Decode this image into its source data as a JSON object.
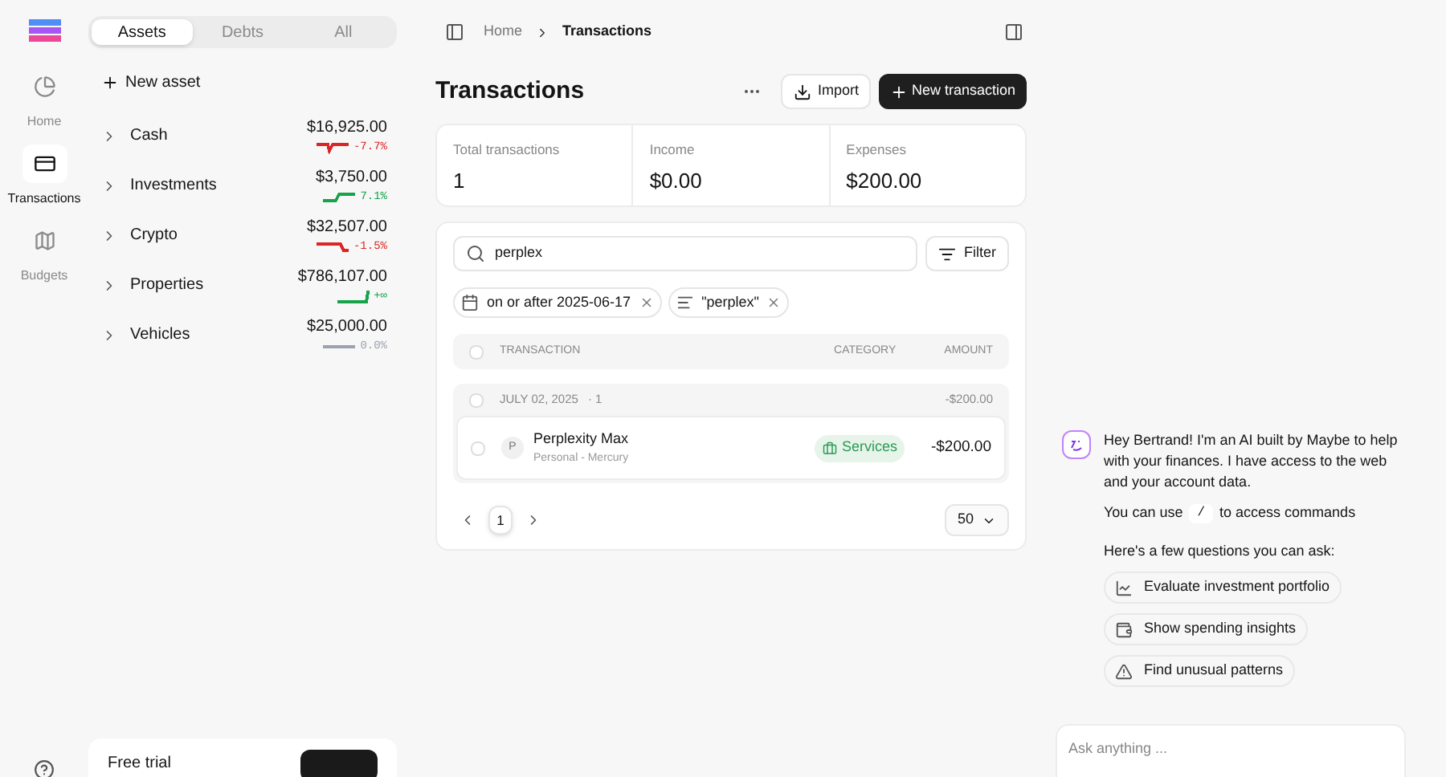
{
  "nav": [
    {
      "label": "Home",
      "selected": false
    },
    {
      "label": "Transactions",
      "selected": true
    },
    {
      "label": "Budgets",
      "selected": false
    }
  ],
  "sidebar": {
    "tabs": [
      {
        "label": "Assets",
        "selected": true
      },
      {
        "label": "Debts",
        "selected": false
      },
      {
        "label": "All",
        "selected": false
      }
    ],
    "new_button": "New asset",
    "accounts": [
      {
        "name": "Cash",
        "amount": "$16,925.00",
        "change": "-7.7%",
        "color": "#dc2626"
      },
      {
        "name": "Investments",
        "amount": "$3,750.00",
        "change": "7.1%",
        "color": "#16a34a"
      },
      {
        "name": "Crypto",
        "amount": "$32,507.00",
        "change": "-1.5%",
        "color": "#dc2626"
      },
      {
        "name": "Properties",
        "amount": "$786,107.00",
        "change": "+∞",
        "color": "#16a34a"
      },
      {
        "name": "Vehicles",
        "amount": "$25,000.00",
        "change": "0.0%",
        "color": "#9ca3af"
      }
    ],
    "trial_card": {
      "title": "Free trial"
    }
  },
  "breadcrumb": [
    "Home",
    "Transactions"
  ],
  "page_title": "Transactions",
  "actions": {
    "import": "Import",
    "new": "New transaction"
  },
  "stats": [
    {
      "label": "Total transactions",
      "value": "1"
    },
    {
      "label": "Income",
      "value": "$0.00"
    },
    {
      "label": "Expenses",
      "value": "$200.00"
    }
  ],
  "search": {
    "value": "perplex"
  },
  "filter_button": "Filter",
  "filters": [
    {
      "kind": "date",
      "label": "on or after 2025-06-17"
    },
    {
      "kind": "text",
      "label": "\"perplex\""
    }
  ],
  "table": {
    "columns": [
      "TRANSACTION",
      "CATEGORY",
      "AMOUNT"
    ],
    "select_all_checked": false,
    "groups": [
      {
        "date": "JULY 02, 2025",
        "count": "· 1",
        "total": "-$200.00",
        "checked": false,
        "rows": [
          {
            "initial": "P",
            "name": "Perplexity Max",
            "account": "Personal - Mercury",
            "category": "Services",
            "amount": "-$200.00",
            "checked": false
          }
        ]
      }
    ]
  },
  "pagination": {
    "pages": [
      {
        "label": "1",
        "selected": true
      }
    ],
    "per_page": "50"
  },
  "chat": {
    "greeting": "Hey Bertrand! I'm an AI built by Maybe to help with your finances. I have access to the web and your account data.",
    "hint_before": "You can use",
    "hint_key": "/",
    "hint_after": "to access commands",
    "questions_title": "Here's a few questions you can ask:",
    "questions": [
      {
        "label": "Evaluate investment portfolio"
      },
      {
        "label": "Show spending insights"
      },
      {
        "label": "Find unusual patterns"
      }
    ],
    "input_placeholder": "Ask anything ..."
  }
}
